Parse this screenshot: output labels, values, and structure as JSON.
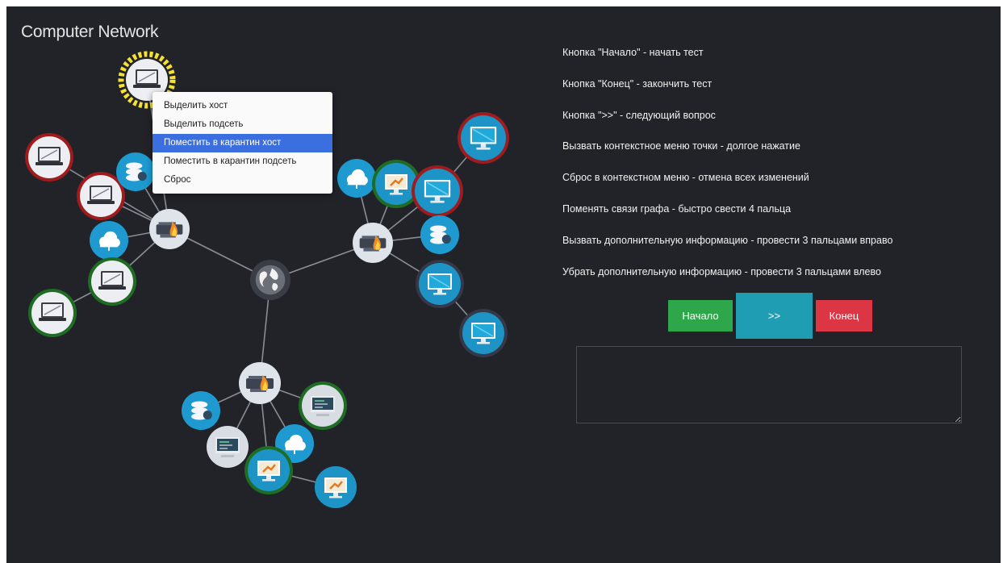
{
  "app": {
    "title": "Computer Network"
  },
  "context_menu": {
    "items": [
      "Выделить хост",
      "Выделить подсеть",
      "Поместить в карантин хост",
      "Поместить в карантин подсеть",
      "Сброс"
    ],
    "active_index": 2
  },
  "help": {
    "lines": [
      "Кнопка \"Начало\" - начать тест",
      "Кнопка \"Конец\" - закончить тест",
      "Кнопка \">>\" - следующий вопрос",
      "Вызвать контекстное меню точки - долгое нажатие",
      "Сброс в контекстном меню - отмена всех изменений",
      "Поменять связи графа - быстро свести 4 пальца",
      "Вызвать дополнительную информацию - провести 3 пальцами вправо",
      "Убрать дополнительную информацию - провести 3 пальцами влево"
    ]
  },
  "buttons": {
    "start": "Начало",
    "next": ">>",
    "end": "Конец"
  },
  "info_box": {
    "value": ""
  },
  "colors": {
    "background": "#222329",
    "selected_ring": "#f5e132",
    "quarantine_ring": "#9e1b1e",
    "subnet_ring": "#1f6d24",
    "start_button": "#2ea64a",
    "next_button": "#1f9db3",
    "end_button": "#dc3543"
  },
  "graph": {
    "nodes": [
      {
        "id": "internet",
        "icon": "globe-icon",
        "ring": "none"
      },
      {
        "id": "router-left",
        "icon": "firewall-icon",
        "ring": "none"
      },
      {
        "id": "router-right",
        "icon": "firewall-icon",
        "ring": "none"
      },
      {
        "id": "router-bottom",
        "icon": "firewall-icon",
        "ring": "none"
      },
      {
        "id": "host-selected",
        "icon": "laptop-icon",
        "ring": "selected"
      },
      {
        "id": "host-l1",
        "icon": "laptop-icon",
        "ring": "quarantine"
      },
      {
        "id": "host-l2",
        "icon": "laptop-icon",
        "ring": "quarantine"
      },
      {
        "id": "host-l3",
        "icon": "database-icon",
        "ring": "none"
      },
      {
        "id": "host-l4",
        "icon": "cloud-icon",
        "ring": "none"
      },
      {
        "id": "host-l5",
        "icon": "laptop-icon",
        "ring": "subnet"
      },
      {
        "id": "host-l6",
        "icon": "laptop-icon",
        "ring": "subnet"
      },
      {
        "id": "host-r1",
        "icon": "cloud-icon",
        "ring": "none"
      },
      {
        "id": "host-r2",
        "icon": "workstation-icon",
        "ring": "subnet"
      },
      {
        "id": "host-r3",
        "icon": "monitor-icon",
        "ring": "quarantine"
      },
      {
        "id": "host-r4",
        "icon": "monitor-icon",
        "ring": "quarantine"
      },
      {
        "id": "host-r5",
        "icon": "database-icon",
        "ring": "none"
      },
      {
        "id": "host-r6",
        "icon": "monitor-icon",
        "ring": "dim"
      },
      {
        "id": "host-r7",
        "icon": "monitor-icon",
        "ring": "dim"
      },
      {
        "id": "host-b1",
        "icon": "database-icon",
        "ring": "none"
      },
      {
        "id": "host-b2",
        "icon": "terminal-icon",
        "ring": "subnet"
      },
      {
        "id": "host-b3",
        "icon": "terminal-icon",
        "ring": "none"
      },
      {
        "id": "host-b4",
        "icon": "cloud-icon",
        "ring": "none"
      },
      {
        "id": "host-b5",
        "icon": "workstation-icon",
        "ring": "subnet"
      },
      {
        "id": "host-b6",
        "icon": "workstation-icon",
        "ring": "none"
      }
    ]
  }
}
